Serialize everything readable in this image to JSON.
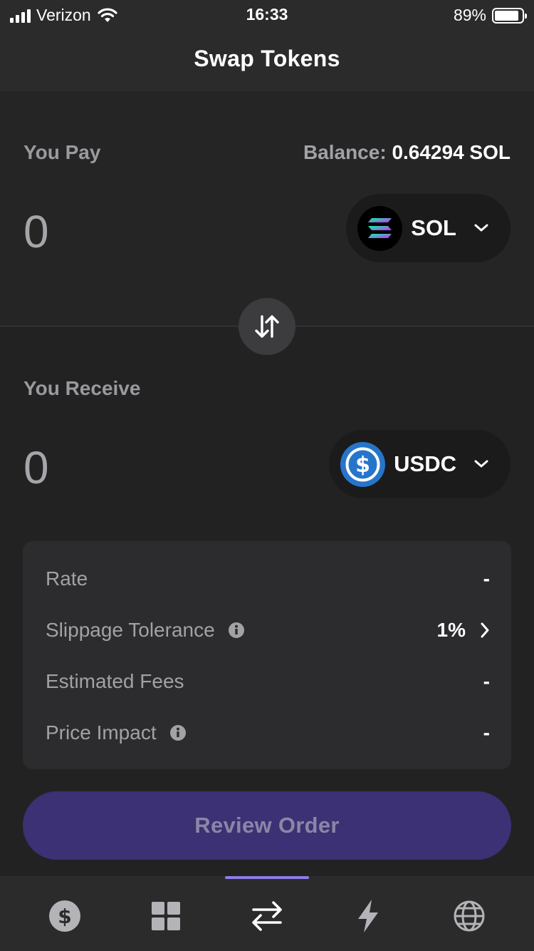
{
  "status_bar": {
    "carrier": "Verizon",
    "time": "16:33",
    "battery_percent": "89%",
    "battery_level": 0.89,
    "signal_bars": 4
  },
  "header": {
    "title": "Swap Tokens"
  },
  "pay": {
    "label": "You Pay",
    "balance_label": "Balance:",
    "balance_value": "0.64294 SOL",
    "amount": "0",
    "token": {
      "symbol": "SOL",
      "icon": "solana-logo-icon"
    }
  },
  "receive": {
    "label": "You Receive",
    "amount": "0",
    "token": {
      "symbol": "USDC",
      "icon": "usdc-logo-icon"
    }
  },
  "details": {
    "rows": [
      {
        "label": "Rate",
        "value": "-"
      },
      {
        "label": "Slippage Tolerance",
        "value": "1%"
      },
      {
        "label": "Estimated Fees",
        "value": "-"
      },
      {
        "label": "Price Impact",
        "value": "-"
      }
    ]
  },
  "review_button": {
    "label": "Review Order"
  },
  "tab_bar": {
    "tabs": [
      {
        "name": "wallet-tab",
        "icon": "dollar-coin-icon"
      },
      {
        "name": "collectibles-tab",
        "icon": "grid-icon"
      },
      {
        "name": "swap-tab",
        "icon": "swap-arrows-icon",
        "active": true
      },
      {
        "name": "activity-tab",
        "icon": "lightning-icon"
      },
      {
        "name": "browser-tab",
        "icon": "globe-icon"
      }
    ]
  },
  "colors": {
    "accent": "#8e7de8",
    "review_button_bg": "#3b3174",
    "usdc_blue": "#2775ca"
  }
}
